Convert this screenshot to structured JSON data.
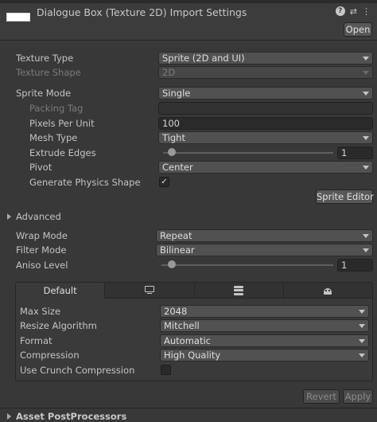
{
  "header": {
    "title": "Dialogue Box (Texture 2D) Import Settings",
    "open_label": "Open",
    "thumbnail_color": "#ffffff"
  },
  "settings": {
    "texture_type": {
      "label": "Texture Type",
      "value": "Sprite (2D and UI)"
    },
    "texture_shape": {
      "label": "Texture Shape",
      "value": "2D"
    },
    "sprite_mode": {
      "label": "Sprite Mode",
      "value": "Single"
    },
    "packing_tag": {
      "label": "Packing Tag",
      "value": ""
    },
    "pixels_per_unit": {
      "label": "Pixels Per Unit",
      "value": "100"
    },
    "mesh_type": {
      "label": "Mesh Type",
      "value": "Tight"
    },
    "extrude_edges": {
      "label": "Extrude Edges",
      "value": "1",
      "fraction": 0.05
    },
    "pivot": {
      "label": "Pivot",
      "value": "Center"
    },
    "generate_physics_shape": {
      "label": "Generate Physics Shape",
      "checked": true,
      "check_glyph": "✓"
    },
    "sprite_editor_label": "Sprite Editor",
    "advanced_label": "Advanced",
    "wrap_mode": {
      "label": "Wrap Mode",
      "value": "Repeat"
    },
    "filter_mode": {
      "label": "Filter Mode",
      "value": "Bilinear"
    },
    "aniso_level": {
      "label": "Aniso Level",
      "value": "1",
      "fraction": 0.06
    }
  },
  "platform": {
    "tabs": [
      {
        "label": "Default",
        "icon": "",
        "active": true
      },
      {
        "label": "",
        "icon": "monitor-icon",
        "active": false
      },
      {
        "label": "",
        "icon": "server-icon",
        "active": false
      },
      {
        "label": "",
        "icon": "android-icon",
        "active": false
      }
    ],
    "max_size": {
      "label": "Max Size",
      "value": "2048"
    },
    "resize_algorithm": {
      "label": "Resize Algorithm",
      "value": "Mitchell"
    },
    "format": {
      "label": "Format",
      "value": "Automatic"
    },
    "compression": {
      "label": "Compression",
      "value": "High Quality"
    },
    "use_crunch_compression": {
      "label": "Use Crunch Compression",
      "checked": false
    }
  },
  "footer": {
    "revert_label": "Revert",
    "apply_label": "Apply",
    "asset_postprocessors_label": "Asset PostProcessors"
  },
  "colors": {
    "background": "#383838",
    "field": "#515151",
    "text": "#c4c4c4"
  }
}
